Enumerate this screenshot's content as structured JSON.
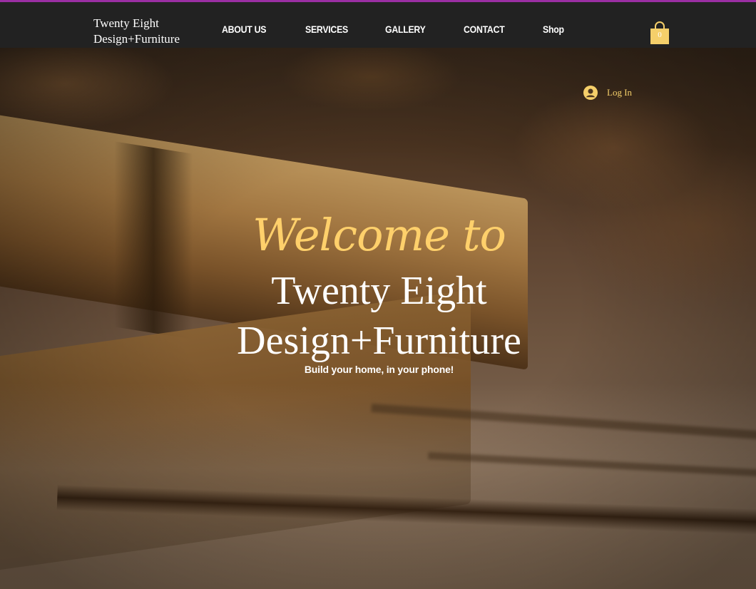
{
  "brand": {
    "line1": "Twenty Eight",
    "line2": "Design+Furniture"
  },
  "nav": {
    "items": [
      {
        "label": "ABOUT US"
      },
      {
        "label": "SERVICES"
      },
      {
        "label": "GALLERY"
      },
      {
        "label": "CONTACT"
      },
      {
        "label": "Shop"
      }
    ]
  },
  "cart": {
    "count": "0",
    "icon": "shopping-bag-icon"
  },
  "login": {
    "label": "Log In",
    "icon": "user-avatar-icon"
  },
  "hero": {
    "welcome": "Welcome to",
    "title_line1": "Twenty Eight",
    "title_line2": "Design+Furniture",
    "tagline": "Build your home, in your phone!"
  },
  "colors": {
    "accent": "#f5cf6a",
    "header_bg": "#222222",
    "top_border": "#9b2fa3"
  }
}
